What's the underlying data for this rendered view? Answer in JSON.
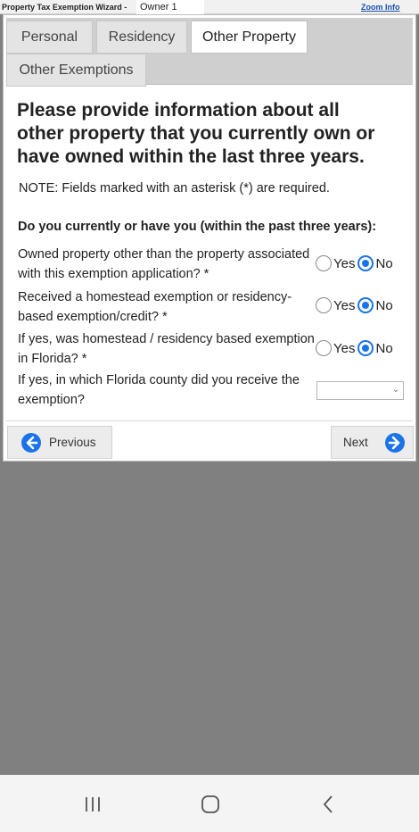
{
  "titlebar": {
    "app_title": "Property Tax Exemption Wizard -",
    "owner": "Owner 1",
    "zoom_link": "Zoom Info"
  },
  "tabs": [
    {
      "label": "Personal",
      "active": false
    },
    {
      "label": "Residency",
      "active": false
    },
    {
      "label": "Other Property",
      "active": true
    },
    {
      "label": "Other Exemptions",
      "active": false
    }
  ],
  "form": {
    "heading": "Please provide information about all other property that you currently own or have owned within the last three years.",
    "note": "NOTE: Fields marked with an asterisk (*) are required.",
    "subheading": "Do you currently or have you (within the past three years):",
    "questions": [
      {
        "text": "Owned property other than the property associated with this exemption application? *",
        "yes_label": "Yes",
        "no_label": "No",
        "selected": "No"
      },
      {
        "text": "Received a homestead exemption or residency-based exemption/credit? *",
        "yes_label": "Yes",
        "no_label": "No",
        "selected": "No"
      },
      {
        "text": "If yes, was homestead / residency based exemption in Florida? *",
        "yes_label": "Yes",
        "no_label": "No",
        "selected": "No"
      }
    ],
    "county_question": "If yes, in which Florida county did you receive the exemption?",
    "county_value": ""
  },
  "nav": {
    "previous_label": "Previous",
    "next_label": "Next"
  },
  "colors": {
    "accent": "#1a73e8",
    "background": "#808080"
  }
}
